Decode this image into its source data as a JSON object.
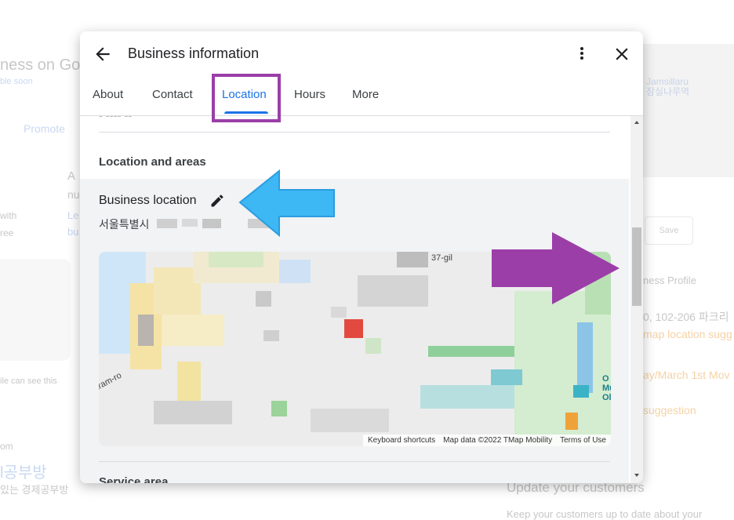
{
  "background": {
    "texts": [
      {
        "name": "bg-title-fragment",
        "text": "ness on Go"
      },
      {
        "name": "bg-sub-fragment",
        "text": "ble soon"
      },
      {
        "name": "bg-promote",
        "text": "Promote"
      },
      {
        "name": "bg-frag-a",
        "text": "A"
      },
      {
        "name": "bg-frag-nu",
        "text": "nu"
      },
      {
        "name": "bg-frag-le",
        "text": "Le"
      },
      {
        "name": "bg-frag-bu",
        "text": "bu"
      },
      {
        "name": "bg-with",
        "text": "with"
      },
      {
        "name": "bg-ree",
        "text": "ree"
      },
      {
        "name": "bg-see-this",
        "text": "ile can see this"
      },
      {
        "name": "bg-om",
        "text": "om"
      },
      {
        "name": "bg-korean-title",
        "text": "l공부방"
      },
      {
        "name": "bg-korean-sub",
        "text": "있는 경제공부방"
      },
      {
        "name": "bg-business-profile",
        "text": "ness Profile"
      },
      {
        "name": "bg-address-fragment",
        "text": "0, 102-206 파크리"
      },
      {
        "name": "bg-map-suggest",
        "text": "map location sugg"
      },
      {
        "name": "bg-holiday",
        "text": "ay/March 1st Mov"
      },
      {
        "name": "bg-suggestion",
        "text": "suggestion"
      },
      {
        "name": "bg-update-title",
        "text": "Update your customers"
      },
      {
        "name": "bg-update-sub",
        "text": "Keep your customers up to date about your"
      }
    ],
    "map_label": "Jamsillaru\n잠실나루역",
    "save_label": "Save"
  },
  "dialog": {
    "title": "Business information",
    "tabs": [
      "About",
      "Contact",
      "Location",
      "Hours",
      "More"
    ],
    "active_tab": "Location",
    "section_title": "Location and areas",
    "business_location_label": "Business location",
    "address_visible": "서울특별시",
    "map": {
      "road_label_1": "37-gil",
      "road_label_2": "aram-ro",
      "poi_label": "O\nMu\nOl",
      "keyboard_shortcuts": "Keyboard shortcuts",
      "map_data": "Map data ©2022 TMap Mobility",
      "terms": "Terms of Use"
    },
    "next_section": "Service area"
  },
  "colors": {
    "accent": "#1a73e8",
    "annotation_purple": "#9b3ea8",
    "annotation_blue": "#3eb7f5"
  },
  "icons": [
    "arrow-back-icon",
    "more-vert-icon",
    "close-icon",
    "pencil-icon",
    "scroll-up-icon",
    "scroll-down-icon"
  ]
}
